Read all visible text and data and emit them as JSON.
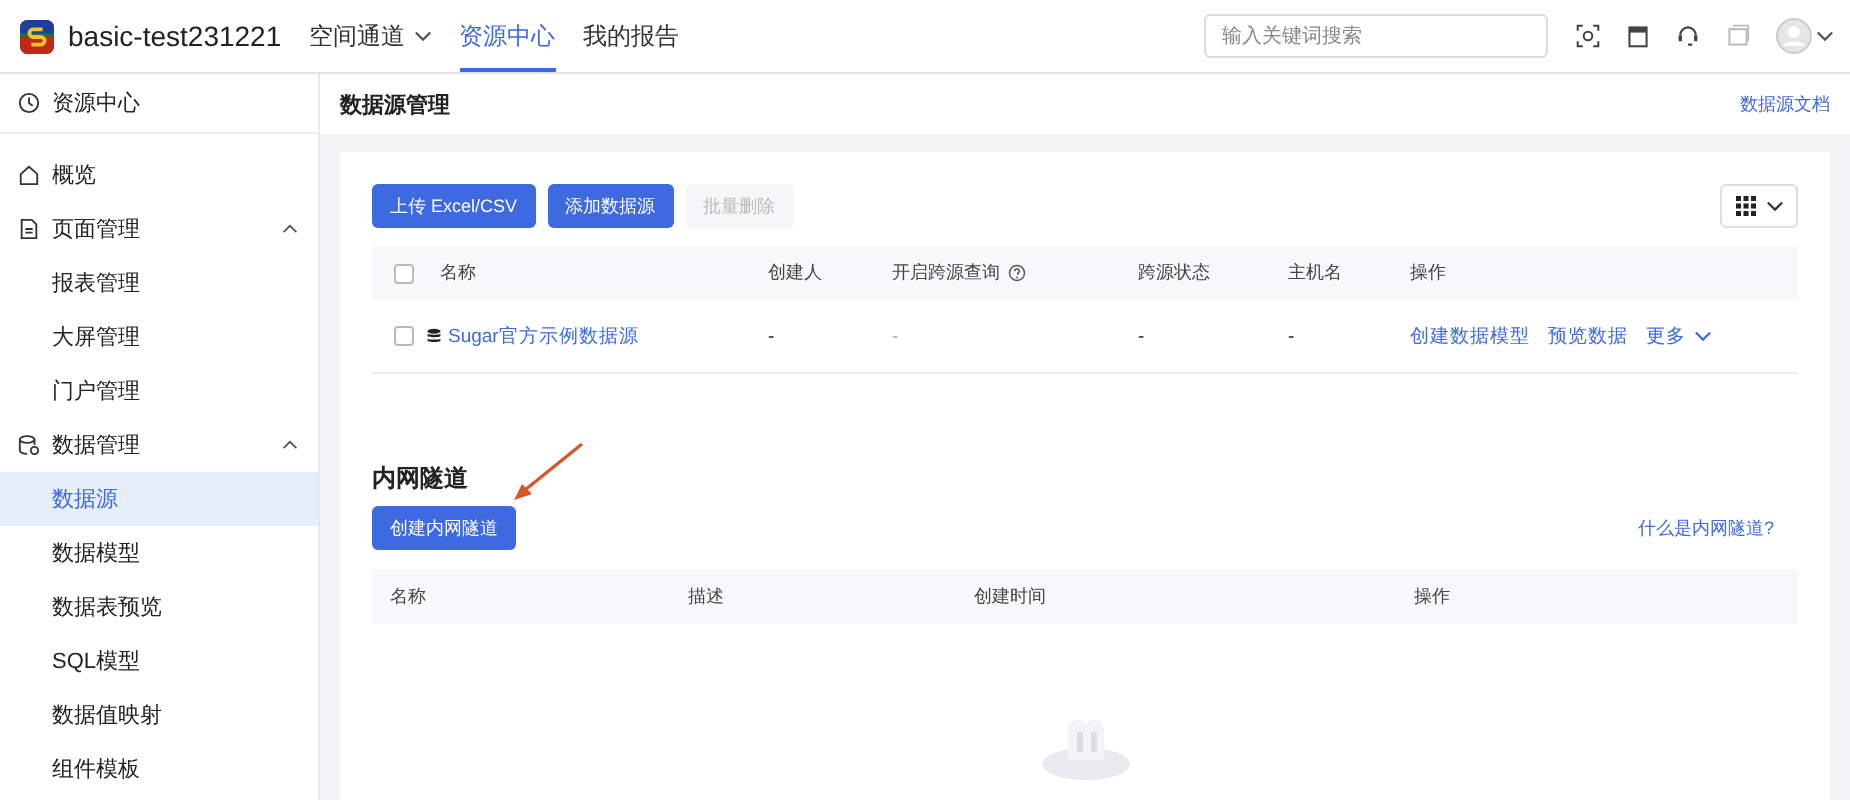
{
  "header": {
    "app_name": "basic-test231221",
    "nav": [
      {
        "label": "空间通道",
        "selected": false,
        "dropdown": true
      },
      {
        "label": "资源中心",
        "selected": true,
        "dropdown": false
      },
      {
        "label": "我的报告",
        "selected": false,
        "dropdown": false
      }
    ],
    "search": {
      "placeholder": "输入关键词搜索"
    }
  },
  "sidebar": {
    "title": "资源中心",
    "items": [
      {
        "label": "概览",
        "kind": "home",
        "selected": false
      },
      {
        "label": "页面管理",
        "kind": "page",
        "expanded": true,
        "children": [
          {
            "label": "报表管理",
            "selected": false
          },
          {
            "label": "大屏管理",
            "selected": false
          },
          {
            "label": "门户管理",
            "selected": false
          }
        ]
      },
      {
        "label": "数据管理",
        "kind": "data",
        "expanded": true,
        "children": [
          {
            "label": "数据源",
            "selected": true
          },
          {
            "label": "数据模型",
            "selected": false
          },
          {
            "label": "数据表预览",
            "selected": false
          },
          {
            "label": "SQL模型",
            "selected": false
          },
          {
            "label": "数据值映射",
            "selected": false
          },
          {
            "label": "组件模板",
            "selected": false
          }
        ]
      }
    ]
  },
  "page": {
    "title": "数据源管理",
    "doc_link": "数据源文档"
  },
  "datasources": {
    "all_checked": false,
    "buttons": [
      {
        "label": "上传 Excel/CSV",
        "disabled": false
      },
      {
        "label": "添加数据源",
        "disabled": false
      },
      {
        "label": "批量删除",
        "disabled": true
      }
    ],
    "columns": [
      {
        "label": "名称",
        "help": false
      },
      {
        "label": "创建人",
        "help": false
      },
      {
        "label": "开启跨源查询",
        "help": true
      },
      {
        "label": "跨源状态",
        "help": false
      },
      {
        "label": "主机名",
        "help": false
      },
      {
        "label": "操作",
        "help": false
      }
    ],
    "rows": [
      {
        "checked": false,
        "name": "Sugar官方示例数据源",
        "creator": "-",
        "cross_query": "-",
        "cross_state": "-",
        "host": "-",
        "actions": [
          {
            "label": "创建数据模型",
            "dropdown": false
          },
          {
            "label": "预览数据",
            "dropdown": false
          },
          {
            "label": "更多",
            "dropdown": true
          }
        ]
      }
    ]
  },
  "tunnels": {
    "title": "内网隧道",
    "button": "创建内网隧道",
    "help_link": "什么是内网隧道?",
    "columns": [
      "名称",
      "描述",
      "创建时间",
      "操作"
    ]
  }
}
